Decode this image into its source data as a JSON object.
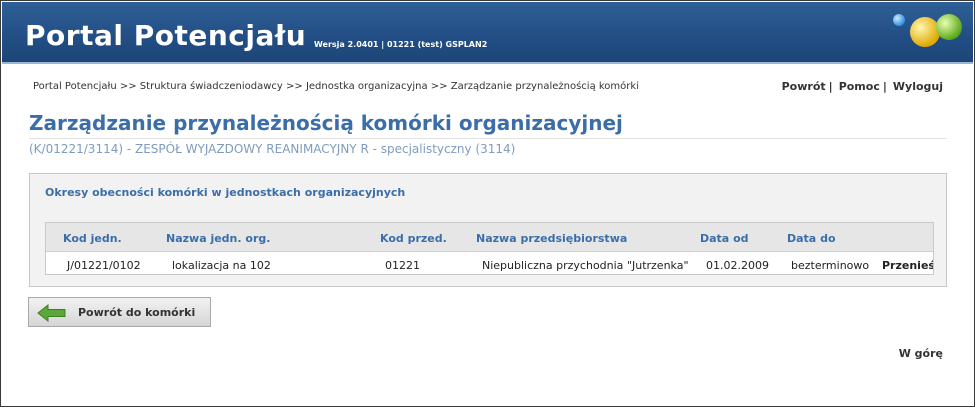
{
  "header": {
    "app_title": "Portal Potencjału",
    "version": "Wersja 2.0401 | 01221 (test) GSPLAN2"
  },
  "breadcrumb": "Portal Potencjału >> Struktura świadczeniodawcy >> Jednostka organizacyjna >> Zarządzanie przynależnością komórki",
  "toplinks": {
    "back": "Powrót",
    "help": "Pomoc",
    "logout": "Wyloguj",
    "separator": "|"
  },
  "page": {
    "title": "Zarządzanie przynależnością komórki organizacyjnej",
    "subtitle": "(K/01221/3114) - ZESPÓŁ WYJAZDOWY REANIMACYJNY R - specjalistyczny (3114)"
  },
  "panel": {
    "title": "Okresy obecności komórki w jednostkach organizacyjnych",
    "columns": [
      "Kod jedn.",
      "Nazwa jedn. org.",
      "Kod przed.",
      "Nazwa przedsiębiorstwa",
      "Data od",
      "Data do"
    ],
    "rows": [
      {
        "kod_jedn": "J/01221/0102",
        "nazwa_jedn": "lokalizacja na 102",
        "kod_przed": "01221",
        "nazwa_przed": "Niepubliczna przychodnia \"Jutrzenka\"",
        "data_od": "01.02.2009",
        "data_do": "bezterminowo",
        "action": "Przenieś"
      }
    ]
  },
  "buttons": {
    "back_to_cell": "Powrót do komórki"
  },
  "footer": {
    "to_top": "W górę"
  },
  "colors": {
    "header_blue": "#234f86",
    "title_blue": "#3b6ea8",
    "subtitle_blue": "#7f9cbd",
    "back_arrow_green": "#5aa83a"
  }
}
